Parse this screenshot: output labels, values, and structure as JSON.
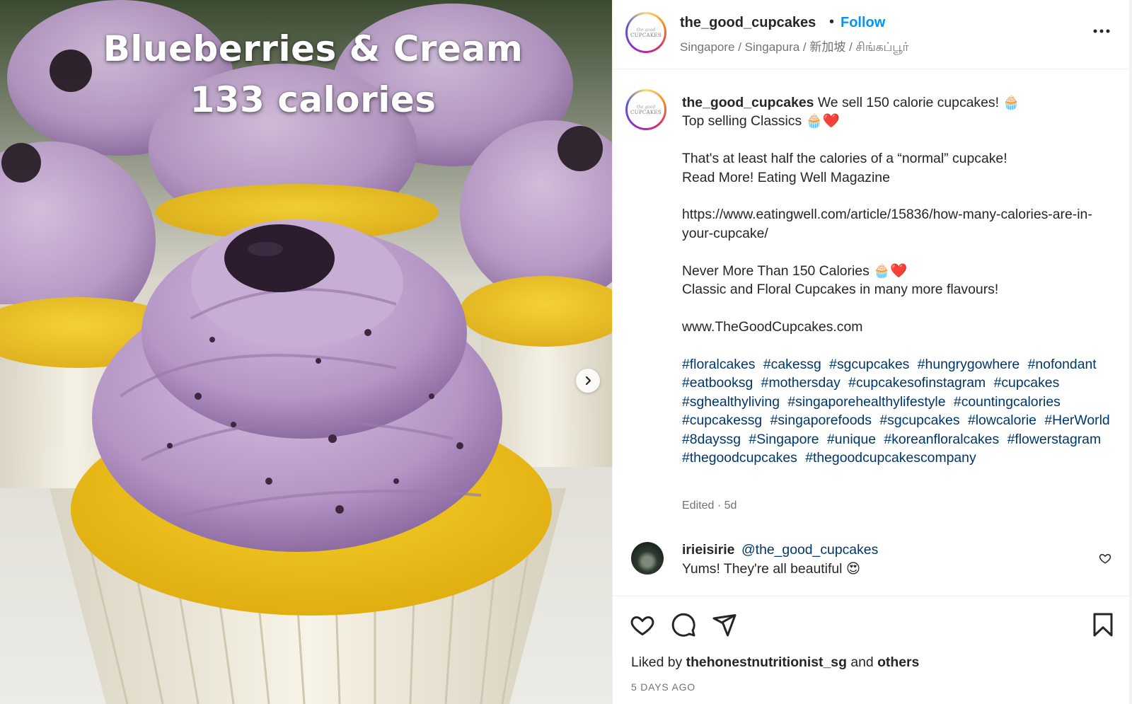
{
  "post": {
    "overlay": {
      "line1": "Blueberries & Cream",
      "line2": "133 calories"
    },
    "next_icon": "chevron-right-icon"
  },
  "header": {
    "username": "the_good_cupcakes",
    "separator": "•",
    "follow_label": "Follow",
    "location": "Singapore / Singapura / 新加坡 / சிங்கப்பூர்",
    "more_icon": "more-horizontal-icon"
  },
  "avatar": {
    "logo_top": "the good",
    "logo_main": "CUPCAKES"
  },
  "caption": {
    "username": "the_good_cupcakes",
    "text": " We sell 150 calorie cupcakes! 🧁\nTop selling Classics 🧁❤️\n\nThat's at least half the calories of a “normal” cupcake!\nRead More! Eating Well Magazine\n\nhttps://www.eatingwell.com/article/15836/how-many-calories-are-in-your-cupcake/\n\nNever More Than 150 Calories 🧁❤️\nClassic and Floral Cupcakes in many more flavours!\n\nwww.TheGoodCupcakes.com",
    "hashtags": [
      "#floralcakes",
      "#cakessg",
      "#sgcupcakes",
      "#hungrygowhere",
      "#nofondant",
      "#eatbooksg",
      "#mothersday",
      "#cupcakesofinstagram",
      "#cupcakes",
      "#sghealthyliving",
      "#singaporehealthylifestyle",
      "#countingcalories",
      "#cupcakessg",
      "#singaporefoods",
      "#sgcupcakes",
      "#lowcalorie",
      "#HerWorld",
      "#8dayssg",
      "#Singapore",
      "#unique",
      "#koreanfloralcakes",
      "#flowerstagram",
      "#thegoodcupcakes",
      "#thegoodcupcakescompany"
    ],
    "edited": "Edited · 5d"
  },
  "comment": {
    "username": "irieisirie",
    "mention": "@the_good_cupcakes",
    "text": "Yums! They're all beautiful 😍",
    "like_icon": "heart-outline-icon"
  },
  "actions": {
    "icons": [
      "heart-icon",
      "comment-icon",
      "share-icon",
      "bookmark-icon"
    ],
    "liked_prefix": "Liked by",
    "liked_user": "thehonestnutritionist_sg",
    "liked_and": "and",
    "liked_others": "others",
    "time": "5 DAYS AGO"
  },
  "colors": {
    "link_blue": "#0095f6",
    "hashtag_blue": "#00376b",
    "frosting": "#b79ac6",
    "cake": "#f2c81e"
  }
}
